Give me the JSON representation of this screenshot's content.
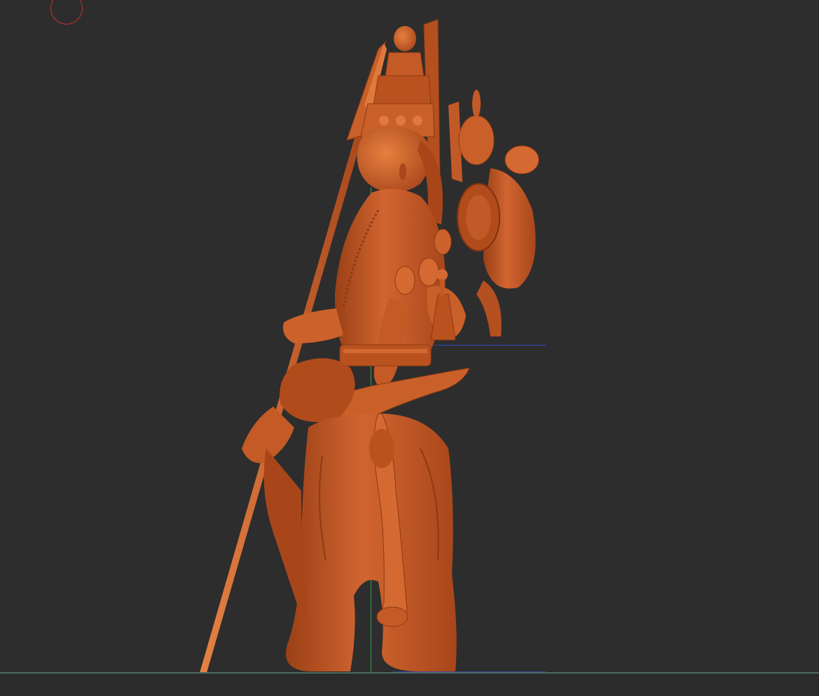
{
  "viewport": {
    "background_color": "#2d2d2d",
    "model_color": "#c45a25",
    "model_shadow_color": "#8e3a12",
    "model_highlight_color": "#e07a3c",
    "axis_colors": {
      "y": "#2f9f4f",
      "x": "#3444b8",
      "floor": "#4b6b60"
    },
    "brush_cursor_color": "#c0302a",
    "model_name": "",
    "icons": [
      "brush-cursor-icon"
    ]
  }
}
